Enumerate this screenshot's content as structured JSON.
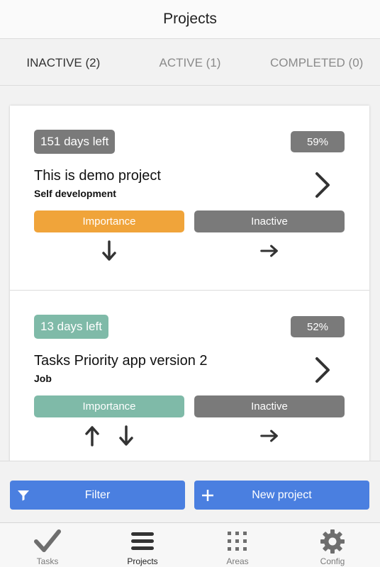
{
  "header": {
    "title": "Projects"
  },
  "tabs": [
    {
      "label": "INACTIVE (2)",
      "active": true
    },
    {
      "label": "ACTIVE (1)",
      "active": false
    },
    {
      "label": "COMPLETED (0)",
      "active": false
    }
  ],
  "projects": [
    {
      "days_left": "151 days left",
      "days_color": "#7a7a7a",
      "progress": "59%",
      "name": "This is demo project",
      "area": "Self development",
      "importance_label": "Importance",
      "importance_color": "#f0a43a",
      "status_label": "Inactive"
    },
    {
      "days_left": "13 days left",
      "days_color": "#7fbaa8",
      "progress": "52%",
      "name": "Tasks Priority app version 2",
      "area": "Job",
      "importance_label": "Importance",
      "importance_color": "#7fbaa8",
      "status_label": "Inactive"
    }
  ],
  "actions": {
    "filter_label": "Filter",
    "new_project_label": "New project",
    "button_color": "#4a7fe0"
  },
  "tabbar": [
    {
      "label": "Tasks",
      "icon": "checkmark-icon",
      "selected": false
    },
    {
      "label": "Projects",
      "icon": "list-icon",
      "selected": true
    },
    {
      "label": "Areas",
      "icon": "grid-icon",
      "selected": false
    },
    {
      "label": "Config",
      "icon": "gear-icon",
      "selected": false
    }
  ]
}
